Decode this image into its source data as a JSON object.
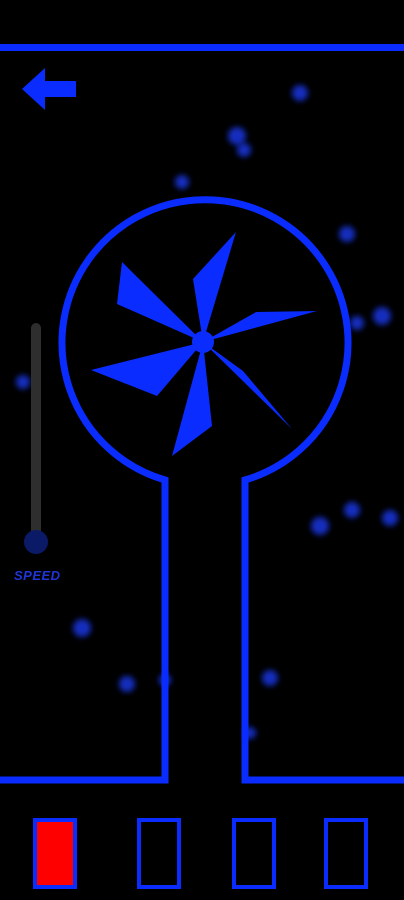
{
  "colors": {
    "accent": "#0a2cff",
    "background": "#000000",
    "slider_track": "#2e2e2e",
    "slider_knob": "#0a1a66",
    "speed_label": "#1f35d8",
    "active_slot": "#ff0000",
    "particle": "#1f3cff"
  },
  "icons": {
    "back": "back-arrow-icon",
    "fan": "pinwheel-fan-icon"
  },
  "speed": {
    "label": "SPEED",
    "value": 0
  },
  "slots": [
    {
      "name": "slot-1",
      "active": true
    },
    {
      "name": "slot-2",
      "active": false
    },
    {
      "name": "slot-3",
      "active": false
    },
    {
      "name": "slot-4",
      "active": false
    }
  ]
}
